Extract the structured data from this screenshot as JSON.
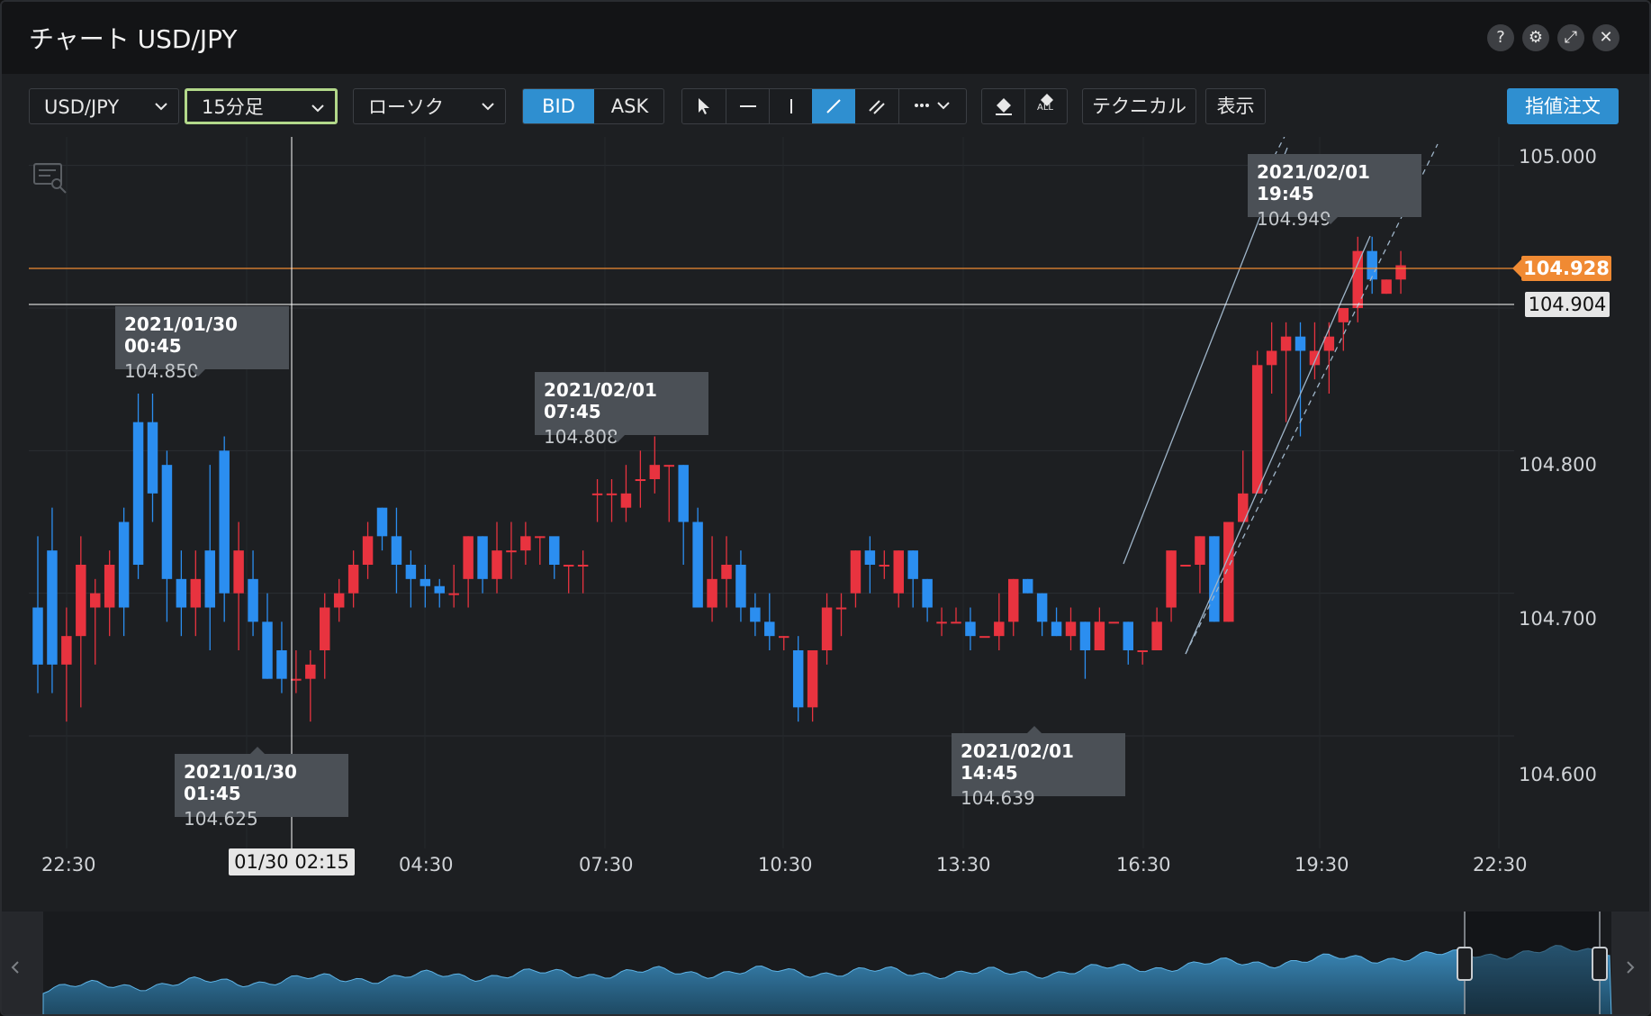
{
  "window": {
    "title": "チャート USD/JPY"
  },
  "window_buttons": [
    "?",
    "⚙",
    "⤢",
    "✕"
  ],
  "toolbar": {
    "symbol": "USD/JPY",
    "timeframe": "15分足",
    "chart_type": "ローソク",
    "bid": "BID",
    "ask": "ASK",
    "technical": "テクニカル",
    "display": "表示",
    "order": "指値注文",
    "eraser_all": "ALL"
  },
  "y_axis_labels": [
    "105.000",
    "104.800",
    "104.700",
    "104.600"
  ],
  "x_axis_labels": [
    "22:30",
    "04:30",
    "07:30",
    "10:30",
    "13:30",
    "16:30",
    "19:30",
    "22:30"
  ],
  "price_tags": {
    "current": "104.928",
    "crosshair": "104.904"
  },
  "crosshair_time": "01/30 02:15",
  "tooltips": [
    {
      "date": "2021/01/30 00:45",
      "price": "104.850"
    },
    {
      "date": "2021/01/30 01:45",
      "price": "104.625"
    },
    {
      "date": "2021/02/01 07:45",
      "price": "104.808"
    },
    {
      "date": "2021/02/01 14:45",
      "price": "104.639"
    },
    {
      "date": "2021/02/01 19:45",
      "price": "104.949"
    }
  ],
  "colors": {
    "up": "#e8333f",
    "down": "#2b8ef0",
    "accent": "#2f8fd0",
    "current_price": "#f08a33"
  },
  "chart_data": {
    "type": "candlestick",
    "ylim": [
      104.54,
      105.02
    ],
    "candles": [
      [
        104.69,
        104.65,
        104.63,
        104.74
      ],
      [
        104.73,
        104.65,
        104.63,
        104.76
      ],
      [
        104.65,
        104.67,
        104.61,
        104.69
      ],
      [
        104.67,
        104.72,
        104.62,
        104.74
      ],
      [
        104.69,
        104.7,
        104.65,
        104.71
      ],
      [
        104.69,
        104.72,
        104.67,
        104.73
      ],
      [
        104.75,
        104.69,
        104.67,
        104.76
      ],
      [
        104.82,
        104.72,
        104.71,
        104.84
      ],
      [
        104.82,
        104.77,
        104.75,
        104.84
      ],
      [
        104.79,
        104.71,
        104.68,
        104.8
      ],
      [
        104.71,
        104.69,
        104.67,
        104.73
      ],
      [
        104.69,
        104.71,
        104.67,
        104.73
      ],
      [
        104.73,
        104.69,
        104.66,
        104.79
      ],
      [
        104.8,
        104.7,
        104.68,
        104.81
      ],
      [
        104.7,
        104.73,
        104.66,
        104.75
      ],
      [
        104.71,
        104.68,
        104.67,
        104.73
      ],
      [
        104.68,
        104.64,
        104.64,
        104.7
      ],
      [
        104.66,
        104.64,
        104.63,
        104.68
      ],
      [
        104.64,
        104.64,
        104.63,
        104.66
      ],
      [
        104.64,
        104.65,
        104.61,
        104.66
      ],
      [
        104.66,
        104.69,
        104.64,
        104.7
      ],
      [
        104.69,
        104.7,
        104.68,
        104.71
      ],
      [
        104.7,
        104.72,
        104.69,
        104.73
      ],
      [
        104.72,
        104.74,
        104.71,
        104.75
      ],
      [
        104.76,
        104.74,
        104.73,
        104.76
      ],
      [
        104.74,
        104.72,
        104.7,
        104.76
      ],
      [
        104.72,
        104.71,
        104.69,
        104.73
      ],
      [
        104.71,
        104.705,
        104.69,
        104.72
      ],
      [
        104.705,
        104.7,
        104.69,
        104.71
      ],
      [
        104.7,
        104.7,
        104.69,
        104.72
      ],
      [
        104.71,
        104.74,
        104.69,
        104.74
      ],
      [
        104.74,
        104.71,
        104.7,
        104.74
      ],
      [
        104.71,
        104.73,
        104.7,
        104.75
      ],
      [
        104.73,
        104.73,
        104.71,
        104.75
      ],
      [
        104.73,
        104.74,
        104.72,
        104.75
      ],
      [
        104.74,
        104.74,
        104.72,
        104.74
      ],
      [
        104.74,
        104.72,
        104.71,
        104.73
      ],
      [
        104.72,
        104.72,
        104.7,
        104.72
      ],
      [
        104.72,
        104.72,
        104.7,
        104.73
      ],
      [
        104.77,
        104.77,
        104.75,
        104.78
      ],
      [
        104.77,
        104.77,
        104.75,
        104.78
      ],
      [
        104.76,
        104.77,
        104.75,
        104.79
      ],
      [
        104.78,
        104.78,
        104.76,
        104.8
      ],
      [
        104.78,
        104.79,
        104.77,
        104.81
      ],
      [
        104.79,
        104.79,
        104.75,
        104.79
      ],
      [
        104.79,
        104.75,
        104.72,
        104.79
      ],
      [
        104.75,
        104.69,
        104.69,
        104.76
      ],
      [
        104.69,
        104.71,
        104.68,
        104.74
      ],
      [
        104.71,
        104.72,
        104.69,
        104.74
      ],
      [
        104.72,
        104.69,
        104.68,
        104.73
      ],
      [
        104.69,
        104.68,
        104.67,
        104.7
      ],
      [
        104.68,
        104.67,
        104.66,
        104.7
      ],
      [
        104.67,
        104.67,
        104.66,
        104.67
      ],
      [
        104.66,
        104.62,
        104.61,
        104.67
      ],
      [
        104.62,
        104.66,
        104.61,
        104.66
      ],
      [
        104.66,
        104.69,
        104.65,
        104.7
      ],
      [
        104.69,
        104.69,
        104.67,
        104.7
      ],
      [
        104.7,
        104.73,
        104.69,
        104.73
      ],
      [
        104.73,
        104.72,
        104.7,
        104.74
      ],
      [
        104.72,
        104.72,
        104.71,
        104.73
      ],
      [
        104.7,
        104.73,
        104.69,
        104.73
      ],
      [
        104.73,
        104.71,
        104.69,
        104.73
      ],
      [
        104.71,
        104.69,
        104.68,
        104.71
      ],
      [
        104.68,
        104.68,
        104.67,
        104.69
      ],
      [
        104.68,
        104.68,
        104.68,
        104.69
      ],
      [
        104.68,
        104.67,
        104.66,
        104.69
      ],
      [
        104.67,
        104.67,
        104.67,
        104.67
      ],
      [
        104.67,
        104.68,
        104.66,
        104.7
      ],
      [
        104.68,
        104.71,
        104.67,
        104.71
      ],
      [
        104.71,
        104.7,
        104.7,
        104.71
      ],
      [
        104.7,
        104.68,
        104.67,
        104.7
      ],
      [
        104.68,
        104.67,
        104.67,
        104.69
      ],
      [
        104.67,
        104.68,
        104.66,
        104.69
      ],
      [
        104.68,
        104.66,
        104.64,
        104.68
      ],
      [
        104.66,
        104.68,
        104.66,
        104.69
      ],
      [
        104.68,
        104.68,
        104.68,
        104.68
      ],
      [
        104.68,
        104.66,
        104.65,
        104.68
      ],
      [
        104.66,
        104.66,
        104.65,
        104.66
      ],
      [
        104.66,
        104.68,
        104.66,
        104.69
      ],
      [
        104.69,
        104.73,
        104.68,
        104.73
      ],
      [
        104.72,
        104.72,
        104.72,
        104.72
      ],
      [
        104.72,
        104.74,
        104.7,
        104.74
      ],
      [
        104.74,
        104.68,
        104.68,
        104.74
      ],
      [
        104.68,
        104.75,
        104.68,
        104.75
      ],
      [
        104.75,
        104.77,
        104.75,
        104.8
      ],
      [
        104.77,
        104.86,
        104.77,
        104.87
      ],
      [
        104.86,
        104.87,
        104.84,
        104.89
      ],
      [
        104.87,
        104.88,
        104.82,
        104.89
      ],
      [
        104.88,
        104.87,
        104.81,
        104.89
      ],
      [
        104.86,
        104.87,
        104.85,
        104.89
      ],
      [
        104.87,
        104.88,
        104.84,
        104.89
      ],
      [
        104.89,
        104.9,
        104.87,
        104.9
      ],
      [
        104.9,
        104.94,
        104.89,
        104.95
      ],
      [
        104.94,
        104.92,
        104.91,
        104.95
      ],
      [
        104.91,
        104.92,
        104.91,
        104.92
      ],
      [
        104.92,
        104.93,
        104.91,
        104.94
      ]
    ]
  }
}
